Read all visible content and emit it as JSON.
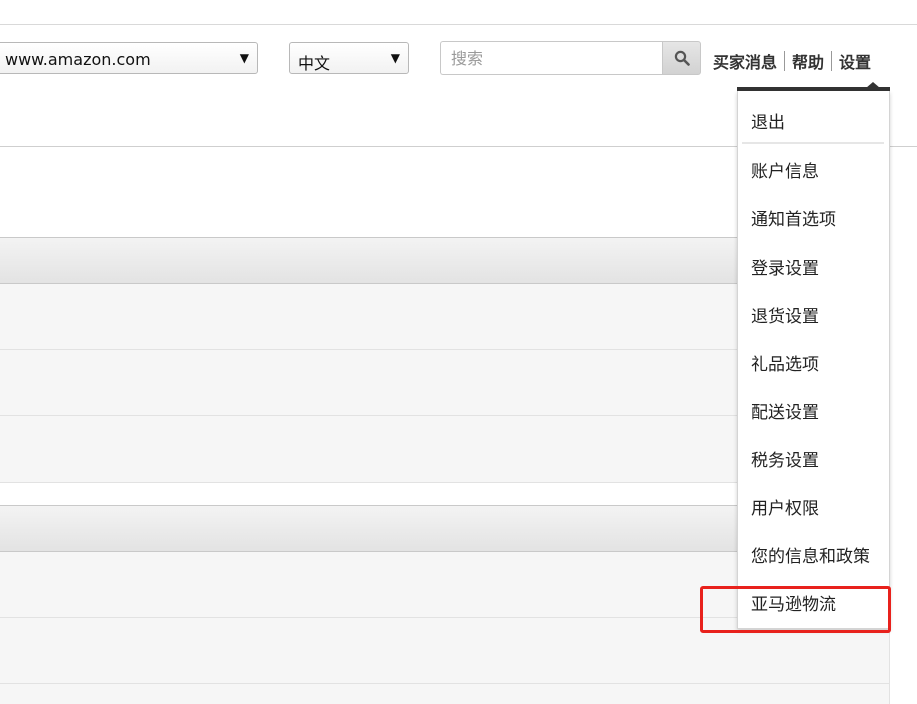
{
  "header": {
    "marketplace": "www.amazon.com",
    "language": "中文",
    "search_placeholder": "搜索",
    "links": {
      "buyer_messages": "买家消息",
      "help": "帮助",
      "settings": "设置"
    }
  },
  "settings_menu": {
    "items": [
      "退出",
      "账户信息",
      "通知首选项",
      "登录设置",
      "退货设置",
      "礼品选项",
      "配送设置",
      "税务设置",
      "用户权限",
      "您的信息和政策",
      "亚马逊物流"
    ],
    "highlighted_item": "亚马逊物流",
    "highlight_color": "#e8211c"
  },
  "icons": {
    "search": "search-icon",
    "dropdown_arrow": "triangle-down-icon"
  }
}
